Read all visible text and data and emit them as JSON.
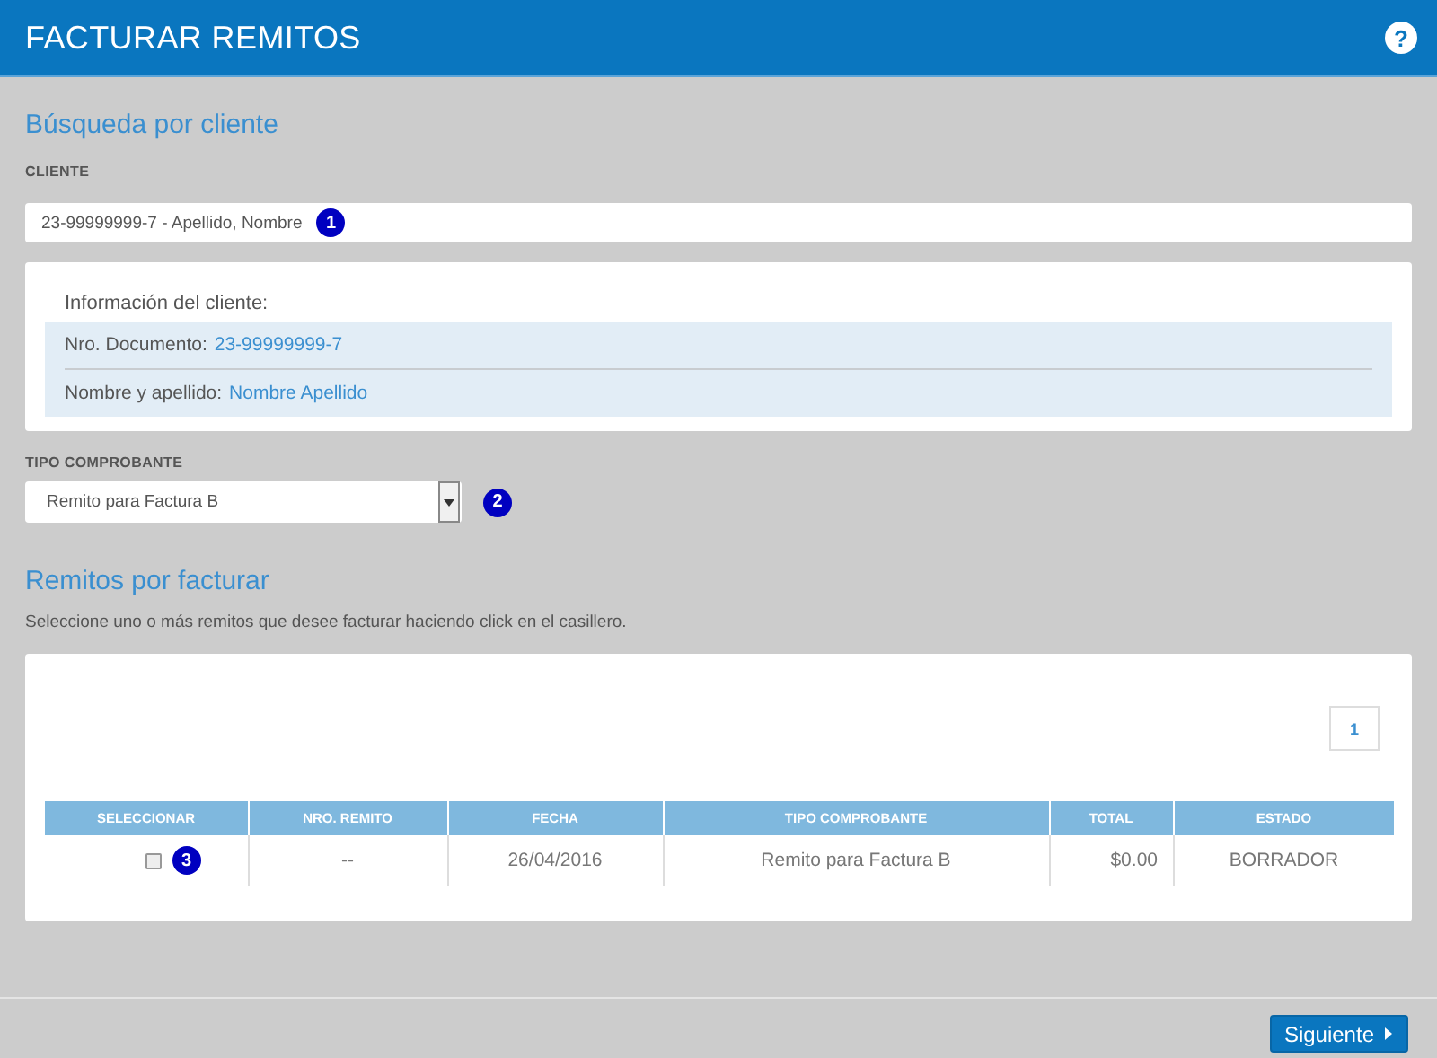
{
  "header": {
    "title": "FACTURAR REMITOS",
    "help": "?"
  },
  "client_search": {
    "heading": "Búsqueda por cliente",
    "client_label": "CLIENTE",
    "client_value": "23-99999999-7 - Apellido, Nombre",
    "client_marker": "1",
    "client_info": {
      "title": "Información del cliente:",
      "fields": [
        {
          "label": "Nro. Documento:",
          "value": "23-99999999-7"
        },
        {
          "label": "Nombre y apellido:",
          "value": "Nombre Apellido"
        }
      ]
    },
    "voucher_type_label": "TIPO COMPROBANTE",
    "voucher_type_value": "Remito para Factura B",
    "voucher_type_marker": "2"
  },
  "pending": {
    "heading": "Remitos por facturar",
    "instructions": "Seleccione uno o más remitos que desee facturar haciendo click en el casillero.",
    "pagination": [
      {
        "label": "1",
        "selected": true
      }
    ],
    "columns": [
      "SELECCIONAR",
      "NRO. REMITO",
      "FECHA",
      "TIPO COMPROBANTE",
      "TOTAL",
      "ESTADO"
    ],
    "rows": [
      {
        "checked": false,
        "cells": [
          "3",
          "--",
          "26/04/2016",
          "Remito para Factura B",
          "$0.00",
          "BORRADOR"
        ]
      }
    ]
  },
  "footer": {
    "next_button": "Siguiente"
  }
}
